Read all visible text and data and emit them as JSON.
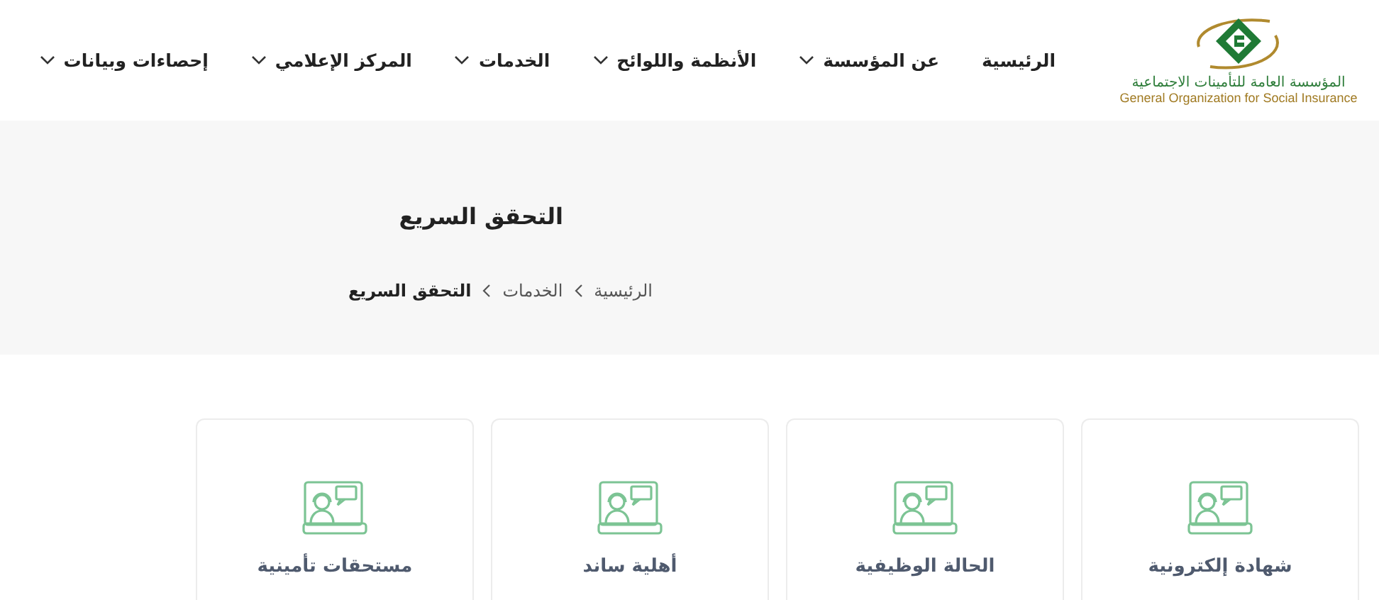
{
  "logo": {
    "name_ar": "المؤسسة العامة للتأمينات الاجتماعية",
    "name_en": "General Organization for Social Insurance"
  },
  "nav": [
    {
      "label": "الرئيسية",
      "has_menu": false
    },
    {
      "label": "عن المؤسسة",
      "has_menu": true
    },
    {
      "label": "الأنظمة واللوائح",
      "has_menu": true
    },
    {
      "label": "الخدمات",
      "has_menu": true
    },
    {
      "label": "المركز الإعلامي",
      "has_menu": true
    },
    {
      "label": "إحصاءات وبيانات",
      "has_menu": true
    }
  ],
  "page_title": "التحقق السريع",
  "breadcrumb": [
    {
      "label": "الرئيسية",
      "current": false
    },
    {
      "label": "الخدمات",
      "current": false
    },
    {
      "label": "التحقق السريع",
      "current": true
    }
  ],
  "cards": [
    {
      "label": "شهادة إلكترونية"
    },
    {
      "label": "الحالة الوظيفية"
    },
    {
      "label": "أهلية ساند"
    },
    {
      "label": "مستحقات تأمينية"
    }
  ]
}
